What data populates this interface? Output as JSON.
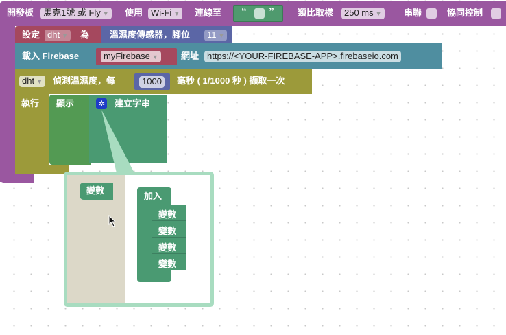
{
  "board": {
    "label": "開發板",
    "board": "馬克1號 或 Fly",
    "use": "使用",
    "conn": "Wi-Fi",
    "connect_to": "連線至",
    "quote_open": "“",
    "quote_close": "”",
    "sampling": "類比取樣",
    "sampling_val": "250 ms",
    "serial": "串聯",
    "coop": "協同控制"
  },
  "set": {
    "label": "設定",
    "var": "dht",
    "as": "為",
    "sensor": "溫濕度傳感器，腳位",
    "pin": "11"
  },
  "firebase": {
    "label": "載入 Firebase",
    "var": "myFirebase",
    "url_label": "網址",
    "url": "https://<YOUR-FIREBASE-APP>.firebaseio.com"
  },
  "dht": {
    "var": "dht",
    "label": "偵測溫濕度，每",
    "ms": "1000",
    "suffix": "毫秒 ( 1/1000 秒 ) 擷取一次",
    "do": "執行"
  },
  "show": {
    "label": "顯示",
    "create": "建立字串"
  },
  "mutator": {
    "flyout_item": "變數",
    "container": "加入",
    "items": [
      "變數",
      "變數",
      "變數",
      "變數"
    ]
  },
  "colors": {
    "purple": "#9a57a0",
    "red": "#a5485e",
    "blue": "#5b66a6",
    "teal": "#4f8ea0",
    "olive": "#9c9a3a",
    "green": "#539a53",
    "text_green": "#4a9a72"
  }
}
